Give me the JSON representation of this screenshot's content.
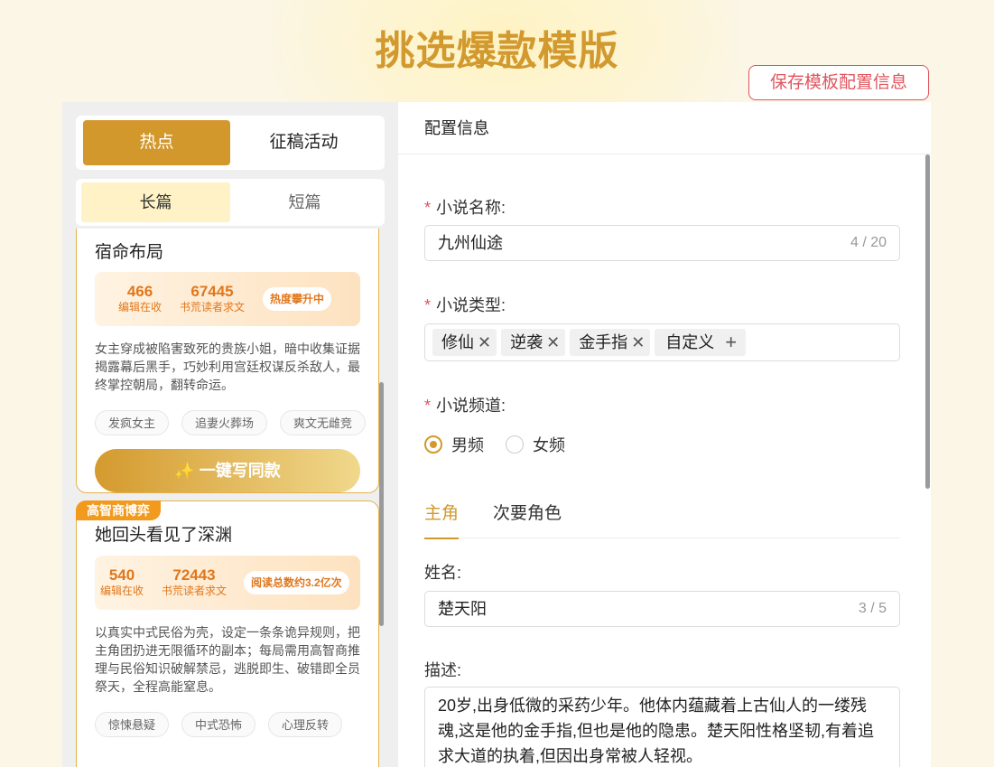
{
  "header": {
    "title": "挑选爆款模版",
    "save_label": "保存模板配置信息"
  },
  "left": {
    "main_tabs": [
      "热点",
      "征稿活动"
    ],
    "sub_tabs": [
      "长篇",
      "短篇"
    ],
    "cards": [
      {
        "title": "宿命布局",
        "editors": "466",
        "editors_label": "编辑在收",
        "readers": "67445",
        "readers_label": "书荒读者求文",
        "badge": "热度攀升中",
        "description": "女主穿成被陷害致死的贵族小姐，暗中收集证据揭露幕后黑手，巧妙利用宫廷权谋反杀敌人，最终掌控朝局，翻转命运。",
        "tags": [
          "发疯女主",
          "追妻火葬场",
          "爽文无雌竞"
        ],
        "button": "✨ 一键写同款"
      },
      {
        "corner": "高智商博弈",
        "title": "她回头看见了深渊",
        "editors": "540",
        "editors_label": "编辑在收",
        "readers": "72443",
        "readers_label": "书荒读者求文",
        "badge": "阅读总数约3.2亿次",
        "description": "以真实中式民俗为壳，设定一条条诡异规则，把主角团扔进无限循环的副本；每局需用高智商推理与民俗知识破解禁忌，逃脱即生、破错即全员祭天，全程高能窒息。",
        "tags": [
          "惊悚悬疑",
          "中式恐怖",
          "心理反转"
        ]
      }
    ]
  },
  "right": {
    "panel_title": "配置信息",
    "novel_name": {
      "label": "小说名称:",
      "value": "九州仙途",
      "count": "4 / 20"
    },
    "novel_type": {
      "label": "小说类型:",
      "chips": [
        "修仙",
        "逆袭",
        "金手指"
      ],
      "custom_label": "自定义"
    },
    "channel": {
      "label": "小说频道:",
      "options": [
        "男频",
        "女频"
      ],
      "selected": "男频"
    },
    "role_tabs": [
      "主角",
      "次要角色"
    ],
    "name_field": {
      "label": "姓名:",
      "value": "楚天阳",
      "count": "3 / 5"
    },
    "desc_field": {
      "label": "描述:",
      "value": "20岁,出身低微的采药少年。他体内蕴藏着上古仙人的一缕残魂,这是他的金手指,但也是他的隐患。楚天阳性格坚韧,有着追求大道的执着,但因出身常被人轻视。"
    }
  },
  "colors": {
    "accent": "#d3982c",
    "danger": "#e0555e",
    "stat_orange": "#e0771c"
  }
}
